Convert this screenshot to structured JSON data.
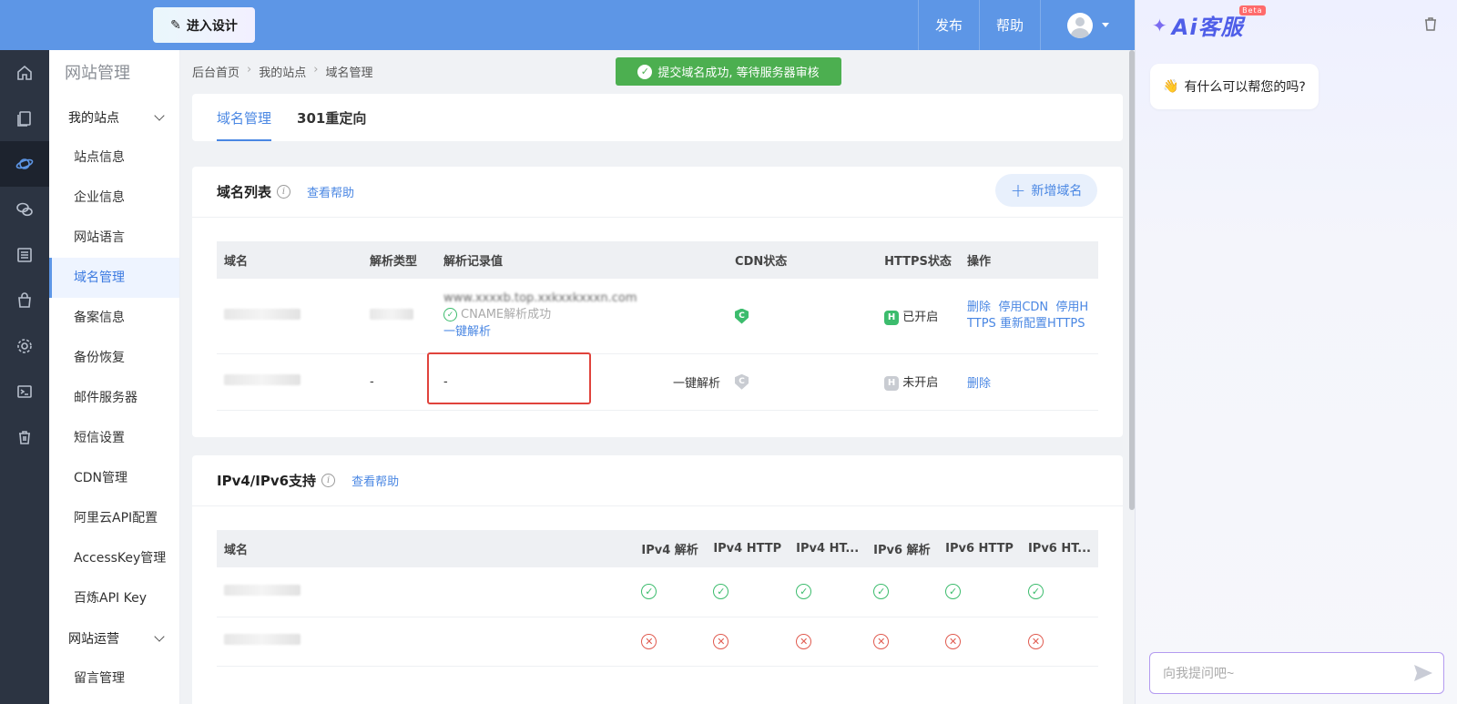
{
  "topbar": {
    "design_label": "进入设计",
    "publish_label": "发布",
    "help_label": "帮助"
  },
  "sidebar": {
    "title": "网站管理",
    "group1": "我的站点",
    "items": [
      "站点信息",
      "企业信息",
      "网站语言",
      "域名管理",
      "备案信息",
      "备份恢复",
      "邮件服务器",
      "短信设置",
      "CDN管理",
      "阿里云API配置",
      "AccessKey管理",
      "百炼API Key"
    ],
    "group2": "网站运营",
    "items2": [
      "留言管理"
    ]
  },
  "breadcrumb": [
    "后台首页",
    "我的站点",
    "域名管理"
  ],
  "toast": "提交域名成功, 等待服务器审核",
  "tabs": [
    "域名管理",
    "301重定向"
  ],
  "domain_list": {
    "title": "域名列表",
    "help": "查看帮助",
    "add_button": "新增域名",
    "columns": [
      "域名",
      "解析类型",
      "解析记录值",
      "CDN状态",
      "HTTPS状态",
      "操作"
    ],
    "rows": [
      {
        "type": "",
        "record": "www.xxxxb.top.xxkxxkxxxn.com",
        "record_status": "CNAME解析成功",
        "record_action": "一键解析",
        "cdn": "C",
        "https_badge": "H",
        "https": "已开启",
        "actions": [
          "删除",
          "停用CDN",
          "停用HTTPS",
          "重新配置HTTPS"
        ]
      },
      {
        "type": "-",
        "record": "-",
        "record_action": "一键解析",
        "cdn": "C",
        "https_badge": "H",
        "https": "未开启",
        "actions": [
          "删除"
        ]
      }
    ]
  },
  "ip_support": {
    "title": "IPv4/IPv6支持",
    "help": "查看帮助",
    "columns": [
      "域名",
      "IPv4 解析",
      "IPv4 HTTP",
      "IPv4 HT...",
      "IPv6 解析",
      "IPv6 HTTP",
      "IPv6 HT..."
    ],
    "rows": [
      {
        "statuses": [
          "ok",
          "ok",
          "ok",
          "ok",
          "ok",
          "ok"
        ]
      },
      {
        "statuses": [
          "bad",
          "bad",
          "bad",
          "bad",
          "bad",
          "bad"
        ]
      }
    ]
  },
  "chat": {
    "logo": "Ai客服",
    "beta": "Beta",
    "greeting": "有什么可以帮您的吗?",
    "input_placeholder": "向我提问吧~"
  },
  "colors": {
    "topbar": "#5d96e6",
    "rail": "#2c3442",
    "accent": "#4a87e3",
    "success": "#4caf50",
    "error": "#e05a4f"
  }
}
